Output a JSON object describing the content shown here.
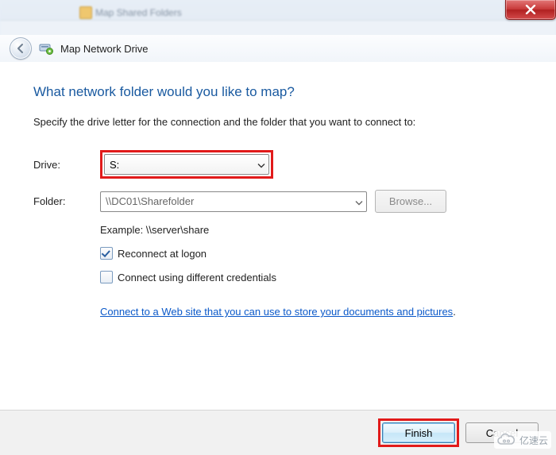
{
  "header": {
    "title": "Map Network Drive"
  },
  "body": {
    "heading": "What network folder would you like to map?",
    "instruction": "Specify the drive letter for the connection and the folder that you want to connect to:",
    "drive_label": "Drive:",
    "drive_value": "S:",
    "folder_label": "Folder:",
    "folder_value": "\\\\DC01\\Sharefolder",
    "browse_label": "Browse...",
    "example_text": "Example: \\\\server\\share",
    "reconnect_label": "Reconnect at logon",
    "reconnect_checked": true,
    "credentials_label": "Connect using different credentials",
    "credentials_checked": false,
    "link_text": "Connect to a Web site that you can use to store your documents and pictures"
  },
  "footer": {
    "finish_label": "Finish",
    "cancel_label": "Cancel"
  },
  "watermark": "亿速云"
}
